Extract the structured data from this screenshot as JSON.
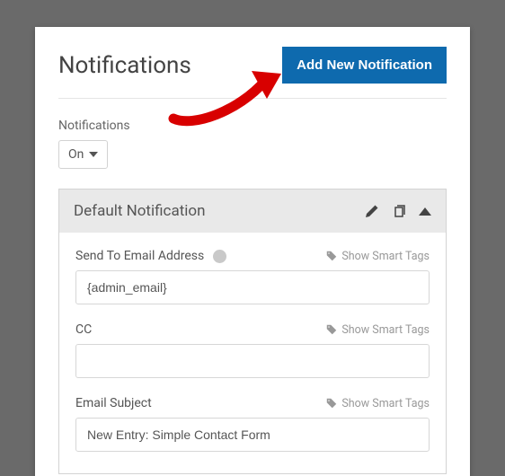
{
  "header": {
    "title": "Notifications",
    "add_button": "Add New Notification"
  },
  "notifications": {
    "label": "Notifications",
    "state": "On"
  },
  "block": {
    "title": "Default Notification",
    "icons": {
      "edit": "pencil-icon",
      "copy": "copy-icon",
      "collapse": "collapse-icon"
    },
    "fields": [
      {
        "label": "Send To Email Address",
        "smart": "Show Smart Tags",
        "value": "{admin_email}",
        "has_help": true
      },
      {
        "label": "CC",
        "smart": "Show Smart Tags",
        "value": "",
        "has_help": false
      },
      {
        "label": "Email Subject",
        "smart": "Show Smart Tags",
        "value": "New Entry: Simple Contact Form",
        "has_help": false
      }
    ]
  }
}
